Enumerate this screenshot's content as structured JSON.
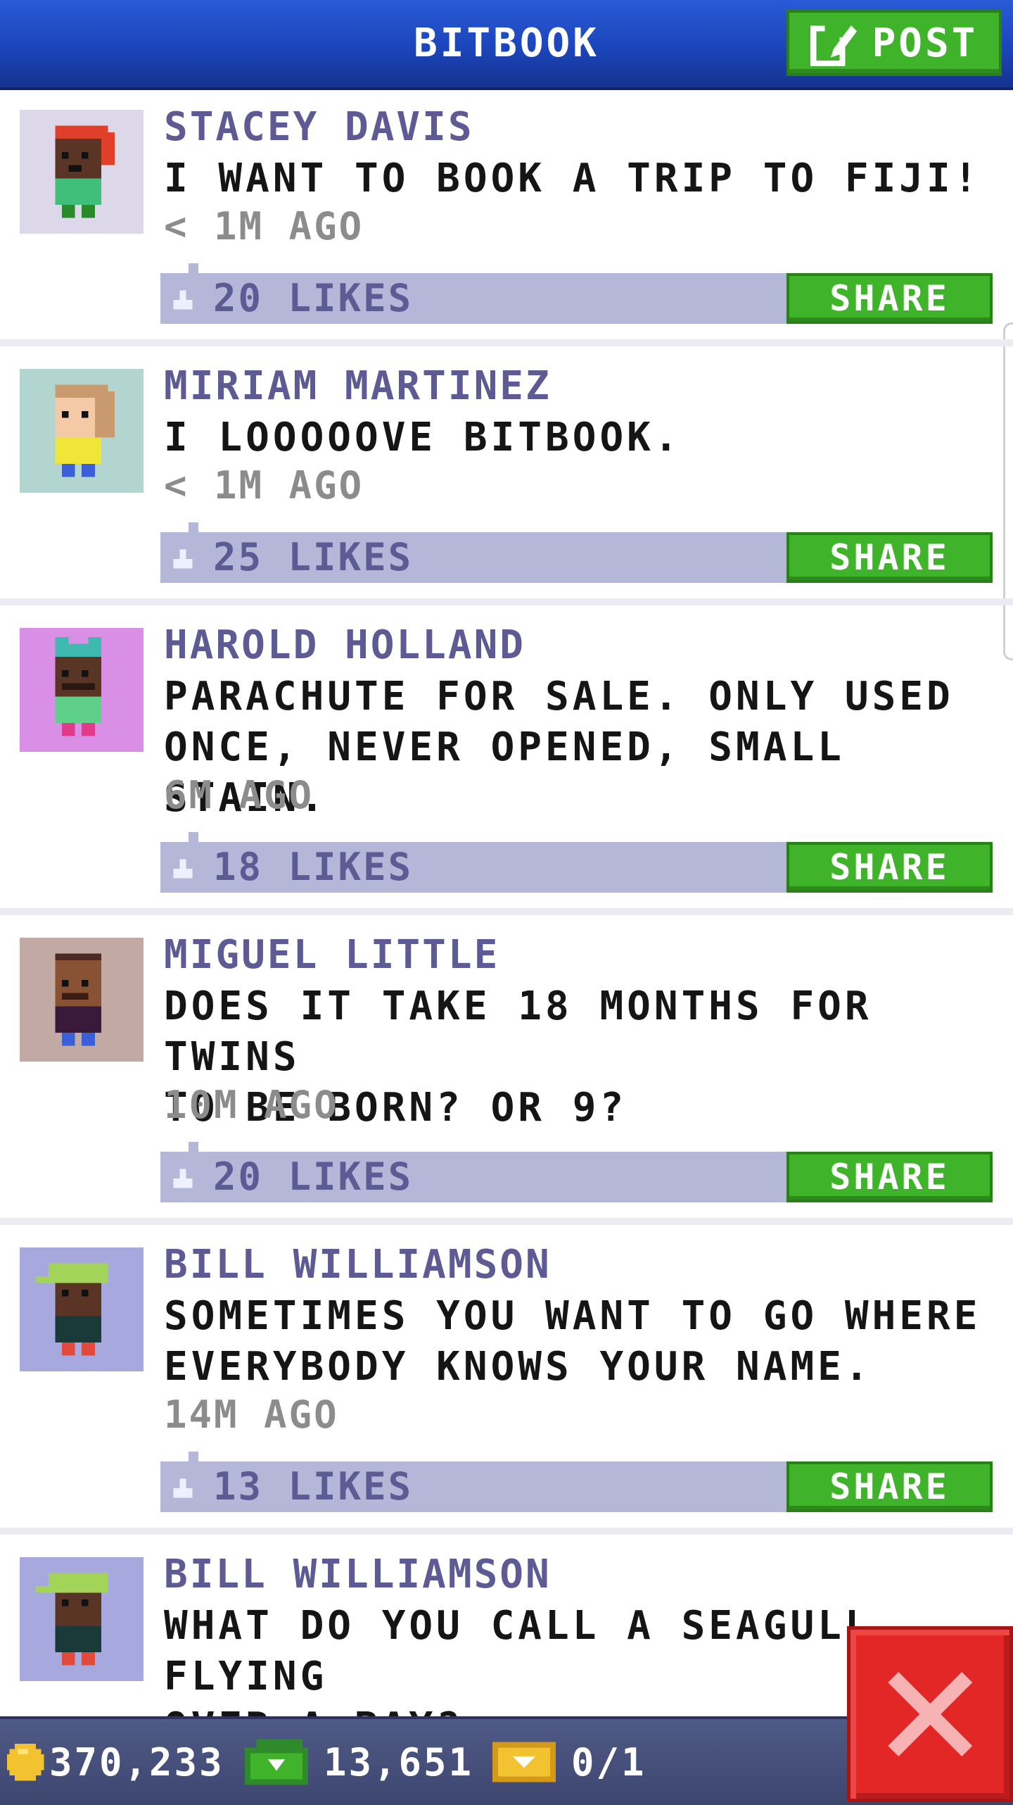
{
  "header": {
    "title": "BITBOOK",
    "post_label": "POST",
    "post_icon": "edit-icon"
  },
  "posts": [
    {
      "author": "STACEY DAVIS",
      "lines": [
        "I WANT TO BOOK A TRIP TO FIJI!"
      ],
      "time": "< 1M AGO",
      "likes": "20 LIKES",
      "share": "SHARE",
      "avatar_bg": "#dcd8ea"
    },
    {
      "author": "MIRIAM MARTINEZ",
      "lines": [
        "I LOOOOOVE BITBOOK."
      ],
      "time": "< 1M AGO",
      "likes": "25 LIKES",
      "share": "SHARE",
      "avatar_bg": "#b2d6cf"
    },
    {
      "author": "HAROLD HOLLAND",
      "lines": [
        "PARACHUTE FOR SALE. ONLY USED",
        "ONCE, NEVER OPENED, SMALL STAIN."
      ],
      "time": "6M AGO",
      "likes": "18 LIKES",
      "share": "SHARE",
      "avatar_bg": "#d98fe6"
    },
    {
      "author": "MIGUEL LITTLE",
      "lines": [
        "DOES IT TAKE 18 MONTHS FOR TWINS",
        "TO BE BORN? OR 9?"
      ],
      "time": "10M AGO",
      "likes": "20 LIKES",
      "share": "SHARE",
      "avatar_bg": "#c2a9a3"
    },
    {
      "author": "BILL WILLIAMSON",
      "lines": [
        "SOMETIMES YOU WANT TO GO WHERE",
        "EVERYBODY KNOWS YOUR NAME."
      ],
      "time": "14M AGO",
      "likes": "13 LIKES",
      "share": "SHARE",
      "avatar_bg": "#a7a9de"
    },
    {
      "author": "BILL WILLIAMSON",
      "lines": [
        "WHAT DO YOU CALL A SEAGULL FLYING",
        "OVER A BAY?"
      ],
      "avatar_bg": "#a7a9de"
    }
  ],
  "stats": {
    "coins": "370,233",
    "bux": "13,651",
    "tickets": "0/1"
  },
  "colors": {
    "header_blue": "#1c45bb",
    "button_green": "#3fb42b",
    "likes_bar": "#b5b7d8",
    "author_purple": "#5e5a94",
    "close_red": "#e32727"
  }
}
